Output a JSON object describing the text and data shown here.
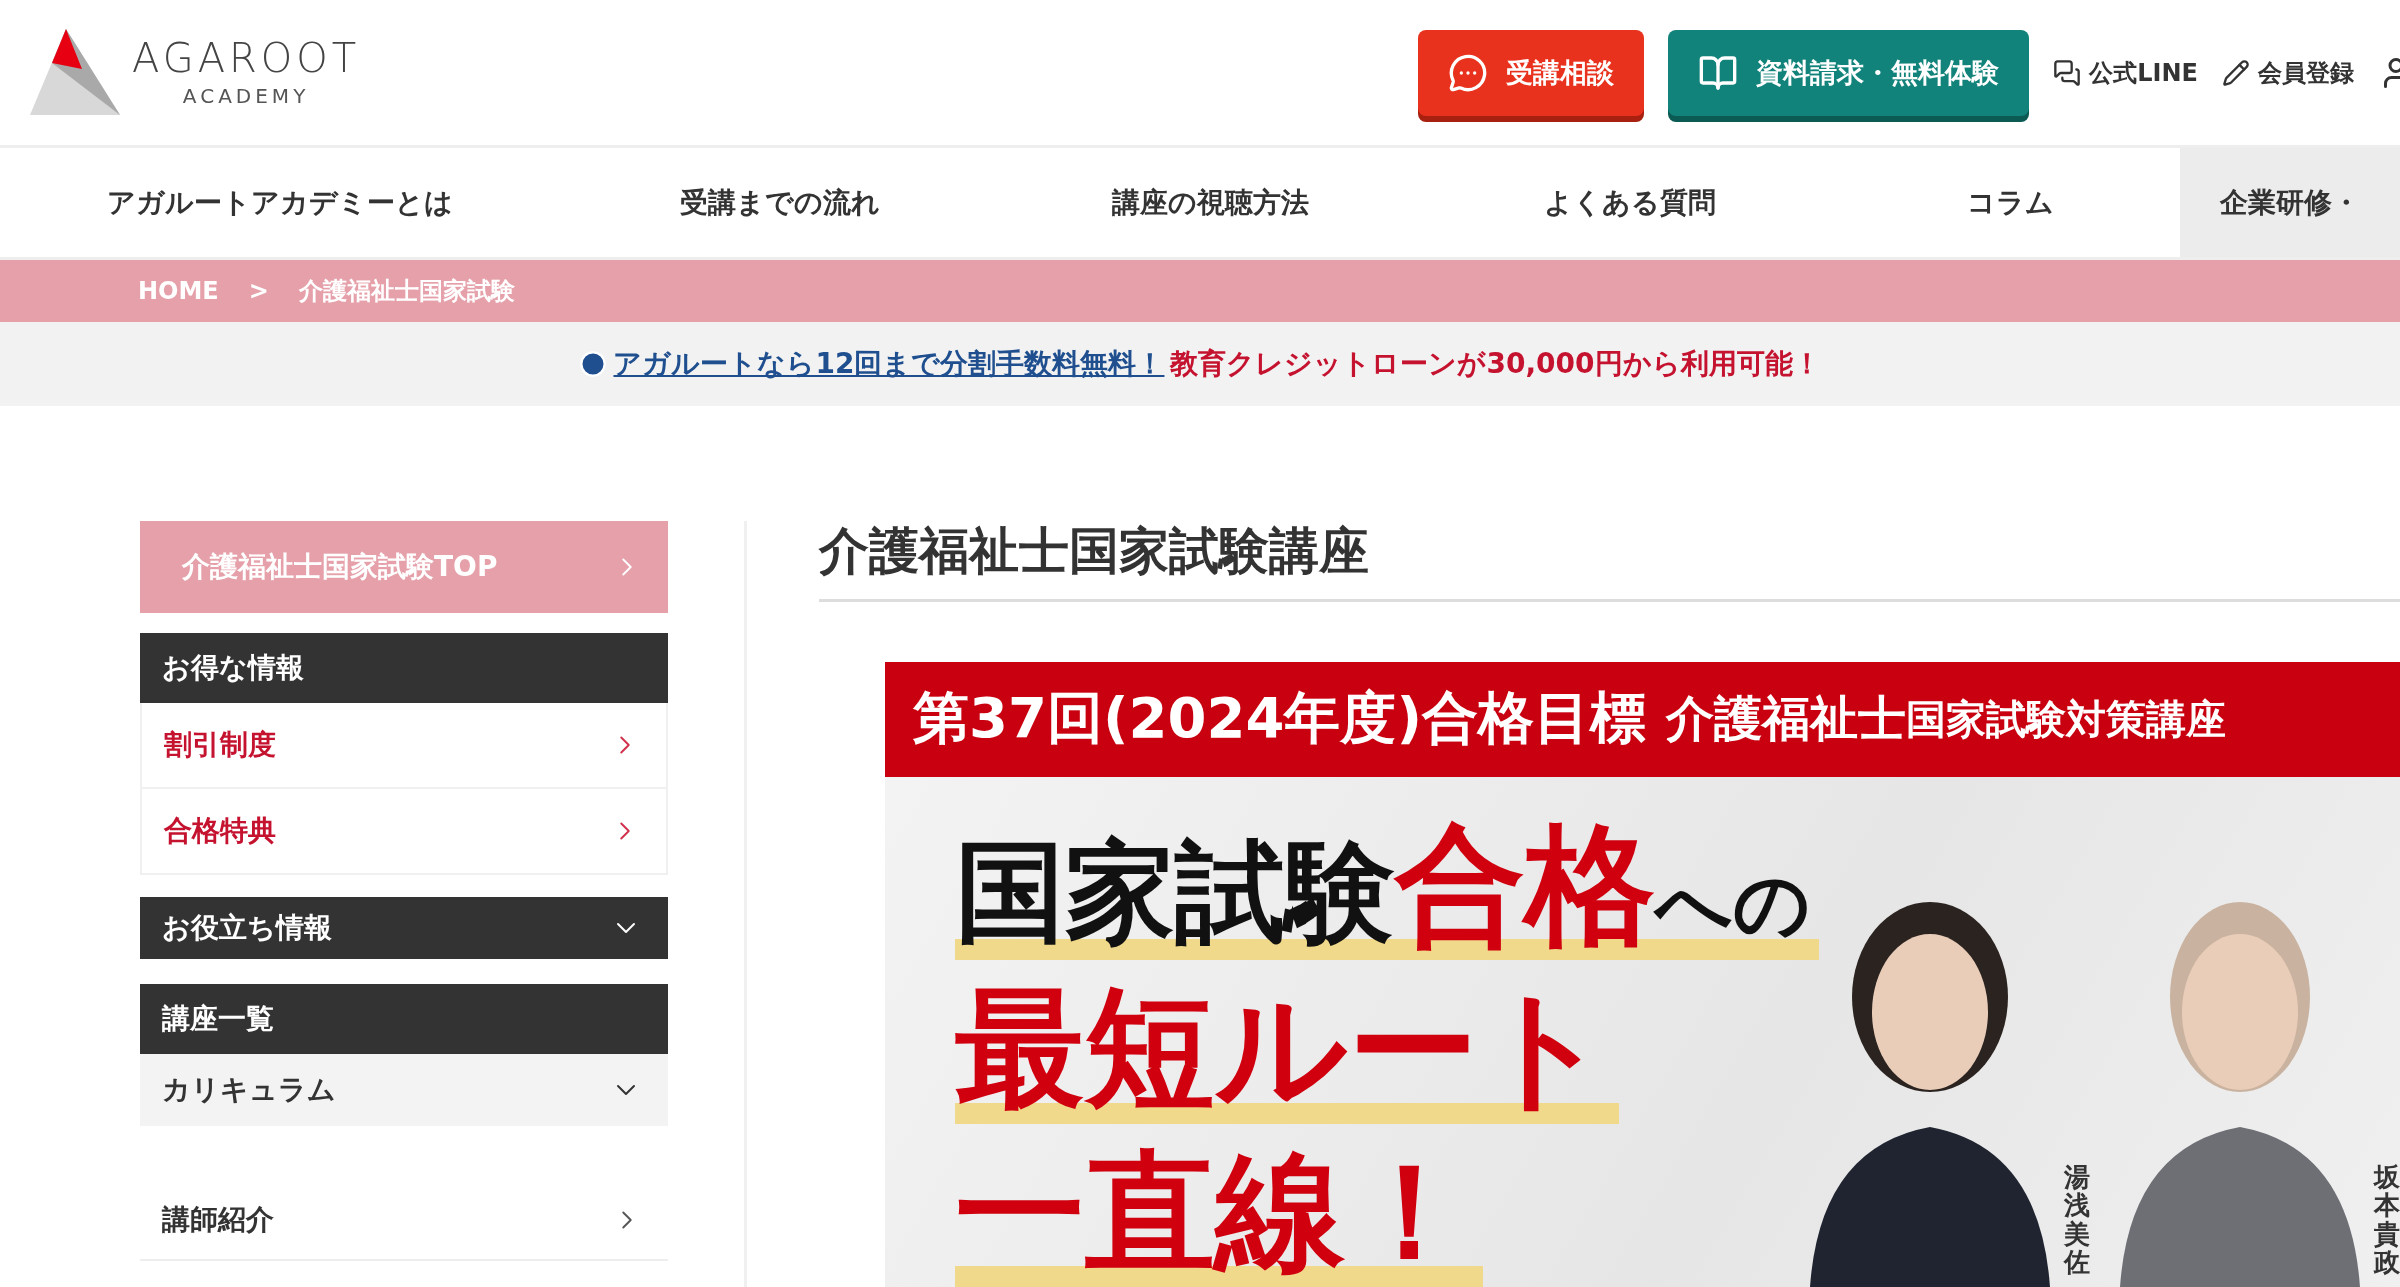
{
  "header": {
    "logo": {
      "name": "AGAROOT",
      "sub": "ACADEMY"
    },
    "actions": [
      {
        "kind": "consult",
        "label": "受講相談"
      },
      {
        "kind": "request",
        "label": "資料請求・無料体験"
      }
    ],
    "links": [
      {
        "kind": "line",
        "label": "公式LINE"
      },
      {
        "kind": "register",
        "label": "会員登録"
      }
    ]
  },
  "nav": [
    {
      "label": "アガルートアカデミーとは",
      "kind": "link"
    },
    {
      "label": "受講までの流れ",
      "kind": "link"
    },
    {
      "label": "講座の視聴方法",
      "kind": "link"
    },
    {
      "label": "よくある質問",
      "kind": "link"
    },
    {
      "label": "コラム",
      "kind": "link"
    },
    {
      "label": "企業研修・",
      "kind": "feature"
    }
  ],
  "breadcrumb": [
    "HOME",
    ">",
    "介護福祉士国家試験"
  ],
  "notice": {
    "link": "アガルートなら12回まで分割手数料無料！",
    "text": "教育クレジットローンが30,000円から利用可能！"
  },
  "sidebar": [
    {
      "kind": "top",
      "label": "介護福祉士国家試験TOP"
    },
    {
      "kind": "heading",
      "label": "お得な情報"
    },
    {
      "kind": "offer",
      "label": "割引制度"
    },
    {
      "kind": "offer",
      "label": "合格特典"
    },
    {
      "kind": "heading_toggle",
      "label": "お役立ち情報",
      "expanded": false
    },
    {
      "kind": "heading",
      "label": "講座一覧"
    },
    {
      "kind": "toggle",
      "label": "カリキュラム",
      "expanded": false
    },
    {
      "kind": "link",
      "label": "講師紹介"
    }
  ],
  "main": {
    "title": "介護福祉士国家試験講座",
    "banner": {
      "band": [
        {
          "kind": "large",
          "text": "第37回(2024年度)合格目標"
        },
        {
          "kind": "medium",
          "text": "介護福祉士"
        },
        {
          "kind": "small",
          "text": "国家試験対策講座"
        }
      ],
      "headline": [
        [
          {
            "kind": "dark",
            "text": "国家試験"
          },
          {
            "kind": "accent",
            "text": "合格"
          },
          {
            "kind": "dark_small",
            "text": "への"
          }
        ],
        [
          {
            "kind": "accent",
            "text": "最短ルート"
          }
        ],
        [
          {
            "kind": "accent",
            "text": "一直線！"
          }
        ]
      ],
      "instructors": [
        {
          "name": "湯浅美佐",
          "kind": "woman"
        },
        {
          "name": "坂本貴政",
          "kind": "man"
        }
      ]
    }
  }
}
